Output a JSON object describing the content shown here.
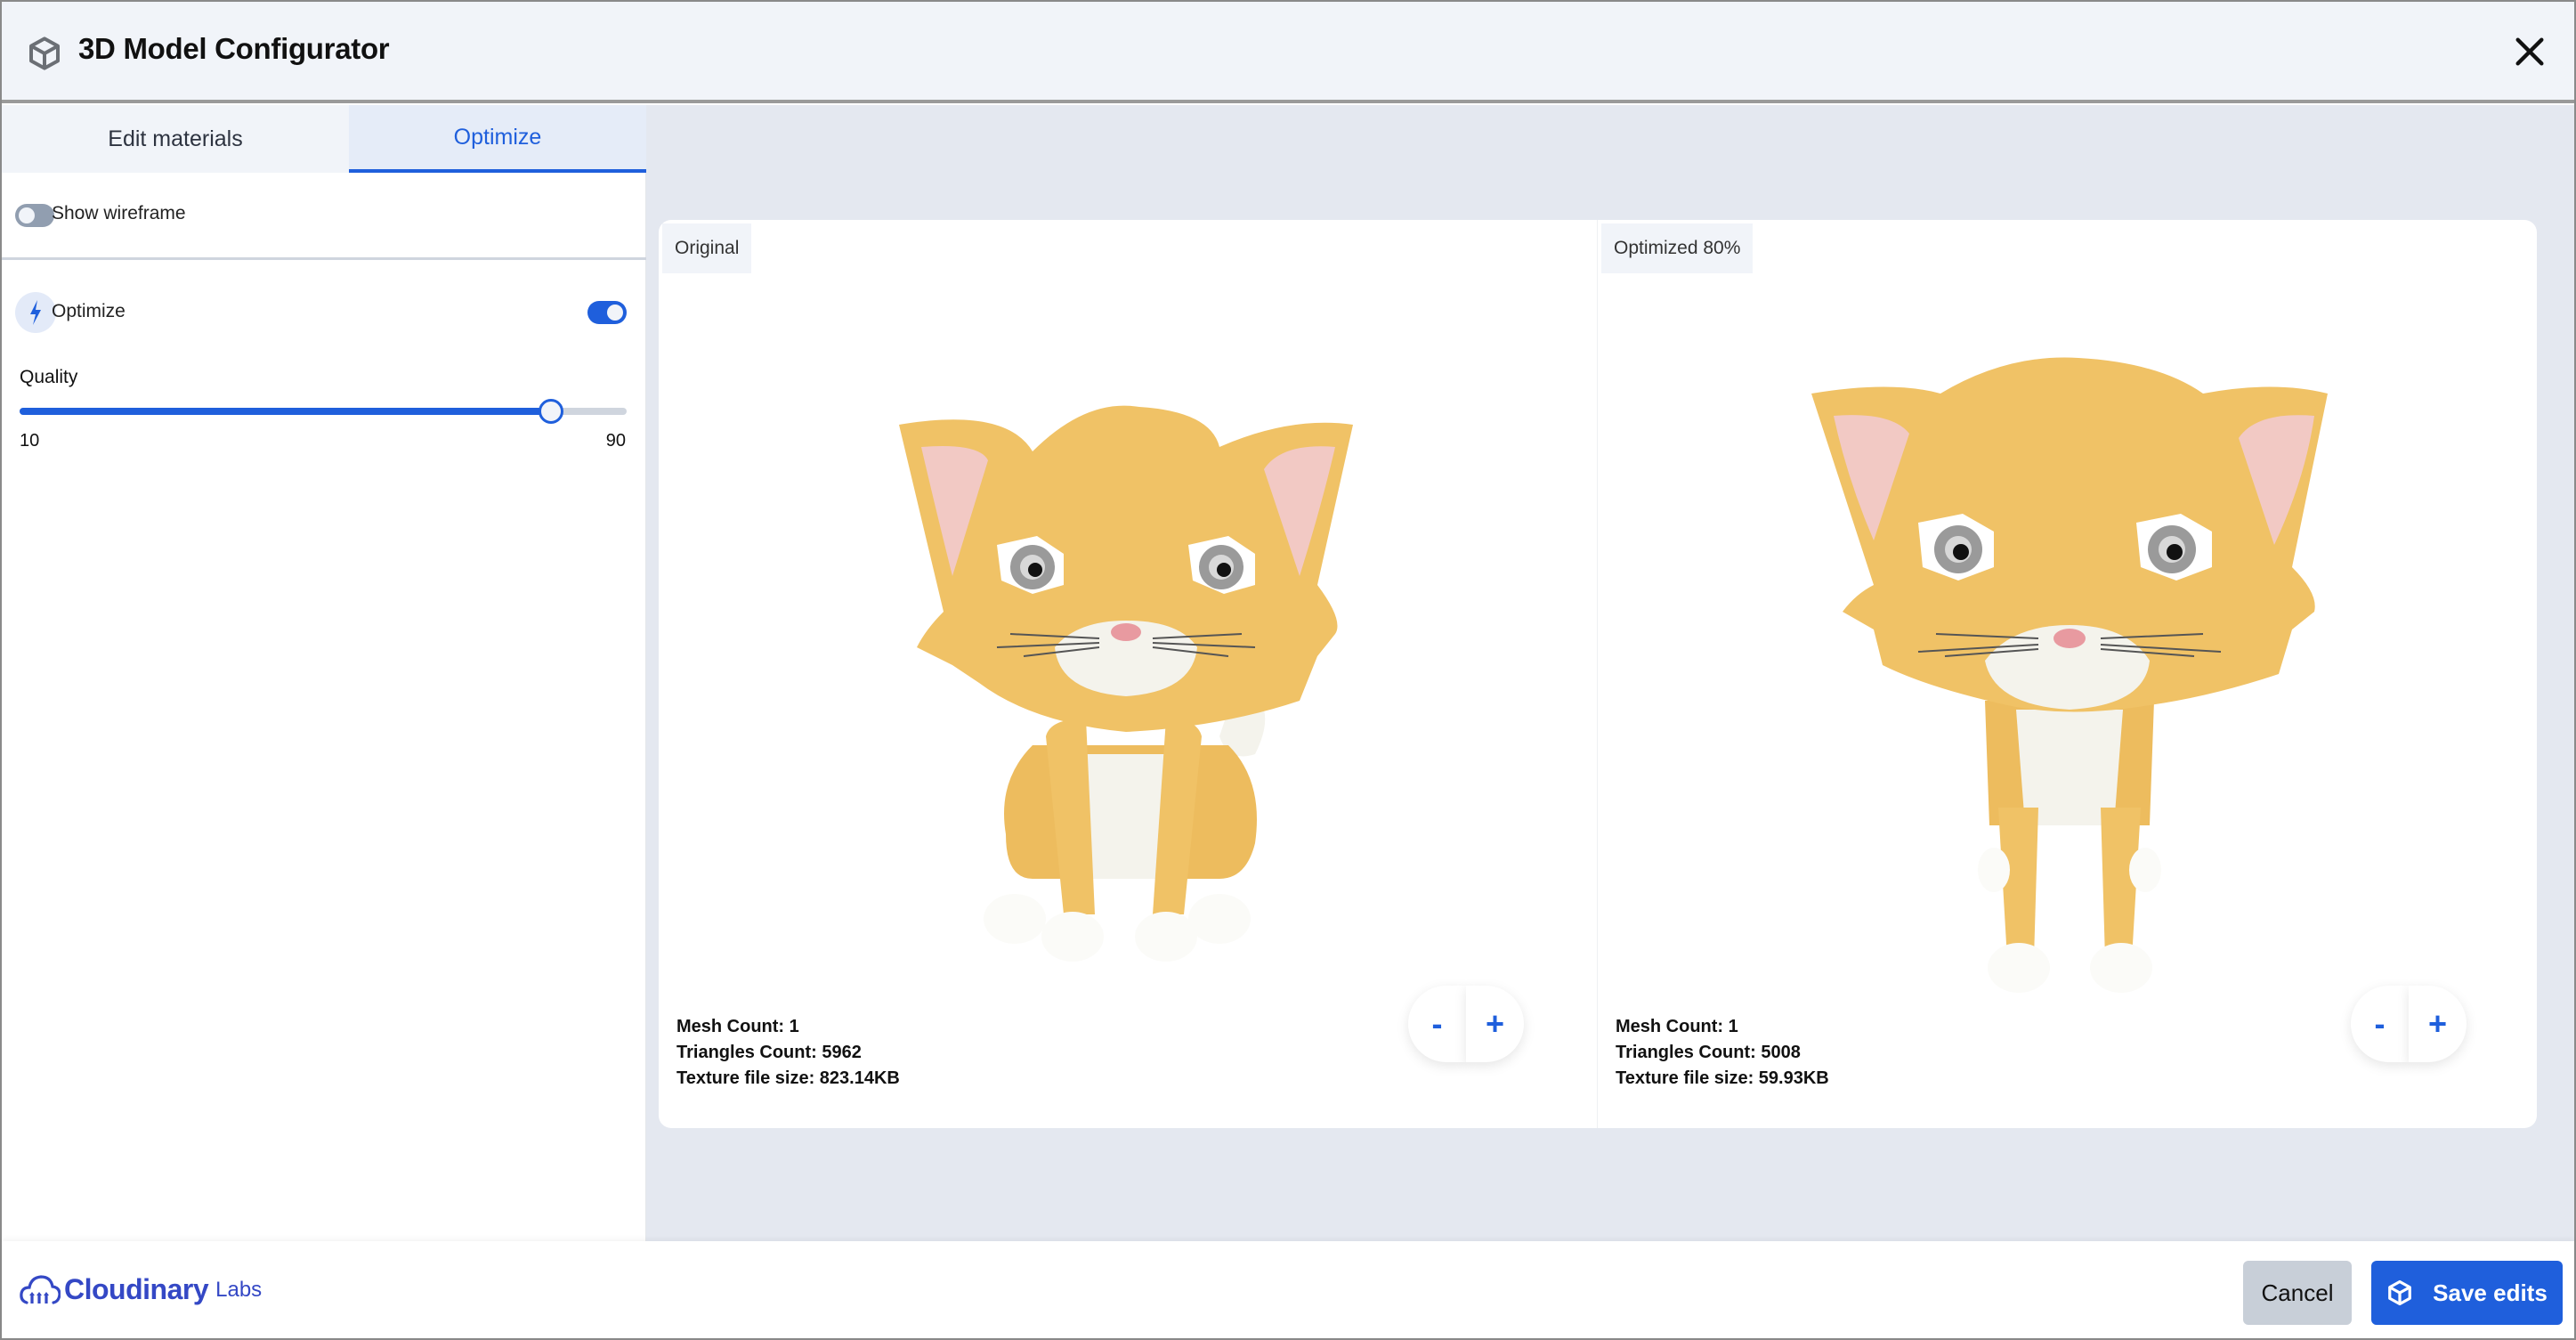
{
  "header": {
    "title": "3D Model Configurator",
    "icon": "cube-icon",
    "close_icon": "close-icon"
  },
  "sidebar": {
    "tabs": [
      {
        "label": "Edit materials",
        "active": false
      },
      {
        "label": "Optimize",
        "active": true
      }
    ],
    "show_wireframe": {
      "label": "Show wireframe",
      "enabled": false
    },
    "optimize": {
      "label": "Optimize",
      "icon": "lightning-icon",
      "enabled": true
    },
    "quality": {
      "label": "Quality",
      "min": 10,
      "max": 90,
      "value": 80,
      "min_label": "10",
      "max_label": "90"
    }
  },
  "viewer": {
    "original": {
      "label": "Original",
      "stats": {
        "mesh": "Mesh Count: 1",
        "triangles": "Triangles Count: 5962",
        "texture": "Texture file size: 823.14KB"
      },
      "zoom_out": "-",
      "zoom_in": "+"
    },
    "optimized": {
      "label": "Optimized 80%",
      "stats": {
        "mesh": "Mesh Count: 1",
        "triangles": "Triangles Count: 5008",
        "texture": "Texture file size: 59.93KB"
      },
      "zoom_out": "-",
      "zoom_in": "+"
    }
  },
  "footer": {
    "brand": "Cloudinary",
    "brand_suffix": "Labs",
    "cancel_label": "Cancel",
    "save_label": "Save edits"
  },
  "colors": {
    "accent": "#1f5fdc",
    "brand": "#3448c5",
    "cat_fur": "#f0c266",
    "cat_white": "#f4f3ec"
  }
}
